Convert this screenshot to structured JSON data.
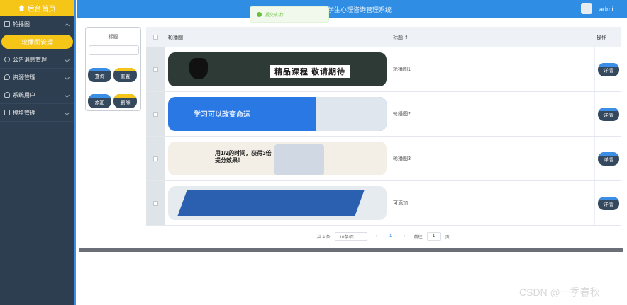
{
  "sidebar": {
    "home_label": "后台首页",
    "groups": [
      {
        "label": "轮播图",
        "expanded": true,
        "sub": "轮播图管理"
      },
      {
        "label": "公告消息管理"
      },
      {
        "label": "资源管理"
      },
      {
        "label": "系统用户"
      },
      {
        "label": "模块管理"
      }
    ]
  },
  "topbar": {
    "title": "大学生心理咨询管理系统",
    "user": "admin"
  },
  "toast": {
    "message": "提交成功!"
  },
  "search": {
    "label": "标题",
    "buttons": {
      "query": "查询",
      "reset": "重置",
      "add": "添加",
      "delete": "删除"
    }
  },
  "table": {
    "headers": {
      "image": "轮播图",
      "title": "标题 ⇕",
      "op": "操作"
    },
    "rows": [
      {
        "title": "轮播图1",
        "banner_text": "精品课程 敬请期待",
        "detail": "详情"
      },
      {
        "title": "轮播图2",
        "banner_text": "学习可以改变命运",
        "detail": "详情"
      },
      {
        "title": "轮播图3",
        "banner_text": "用1/2的时间，获得3倍提分效果！",
        "detail": "详情"
      },
      {
        "title": "可添加",
        "banner_text": "",
        "detail": "详情"
      }
    ]
  },
  "pagination": {
    "total": "共 4 条",
    "page_size": "10条/页",
    "prev": "‹",
    "current": "1",
    "next": "›",
    "goto_label": "前往",
    "goto_value": "1",
    "page_suffix": "页"
  },
  "watermark": "CSDN @一季春秋",
  "colors": {
    "accent": "#2f8ee3",
    "sidebar": "#2c3e50",
    "highlight": "#f5c518"
  }
}
